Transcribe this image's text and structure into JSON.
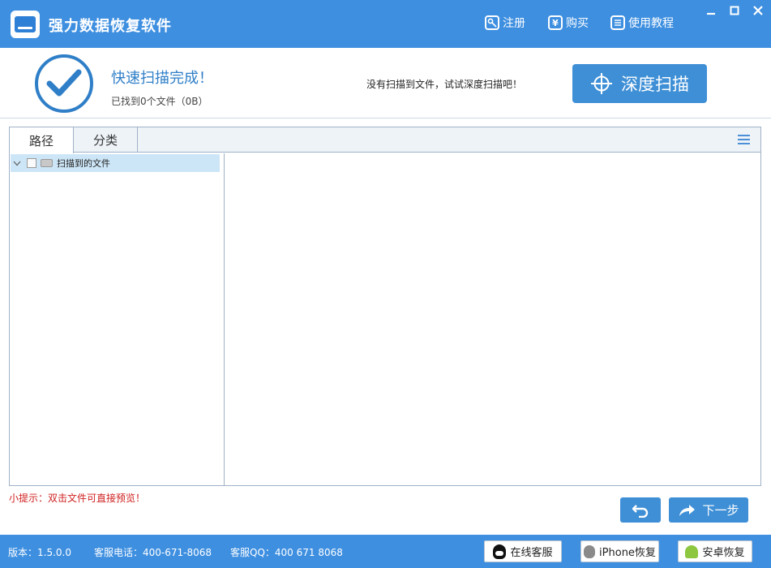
{
  "app": {
    "title": "强力数据恢复软件"
  },
  "titlebar": {
    "register_label": "注册",
    "buy_label": "购买",
    "tutorial_label": "使用教程"
  },
  "status": {
    "scan_done": "快速扫描完成！",
    "found_text": "已找到0个文件（0B）",
    "deep_hint": "没有扫描到文件，试试深度扫描吧！",
    "deep_scan_label": "深度扫描"
  },
  "tabs": [
    {
      "label": "路径",
      "active": true
    },
    {
      "label": "分类",
      "active": false
    }
  ],
  "tree": {
    "root_label": "扫描到的文件",
    "checked": false,
    "expanded": true
  },
  "tip": "小提示：双击文件可直接预览！",
  "nav": {
    "back_icon": "undo-icon",
    "next_label": "下一步"
  },
  "footer": {
    "version": "版本：1.5.0.0",
    "phone": "客服电话：400-671-8068",
    "qq": "客服QQ：400 671 8068",
    "online_service_label": "在线客服",
    "iphone_label": "iPhone恢复",
    "android_label": "安卓恢复"
  },
  "colors": {
    "accent": "#3e8fe0",
    "button": "#3e8fd6",
    "tip": "#d02020",
    "selection": "#cde6f7"
  }
}
